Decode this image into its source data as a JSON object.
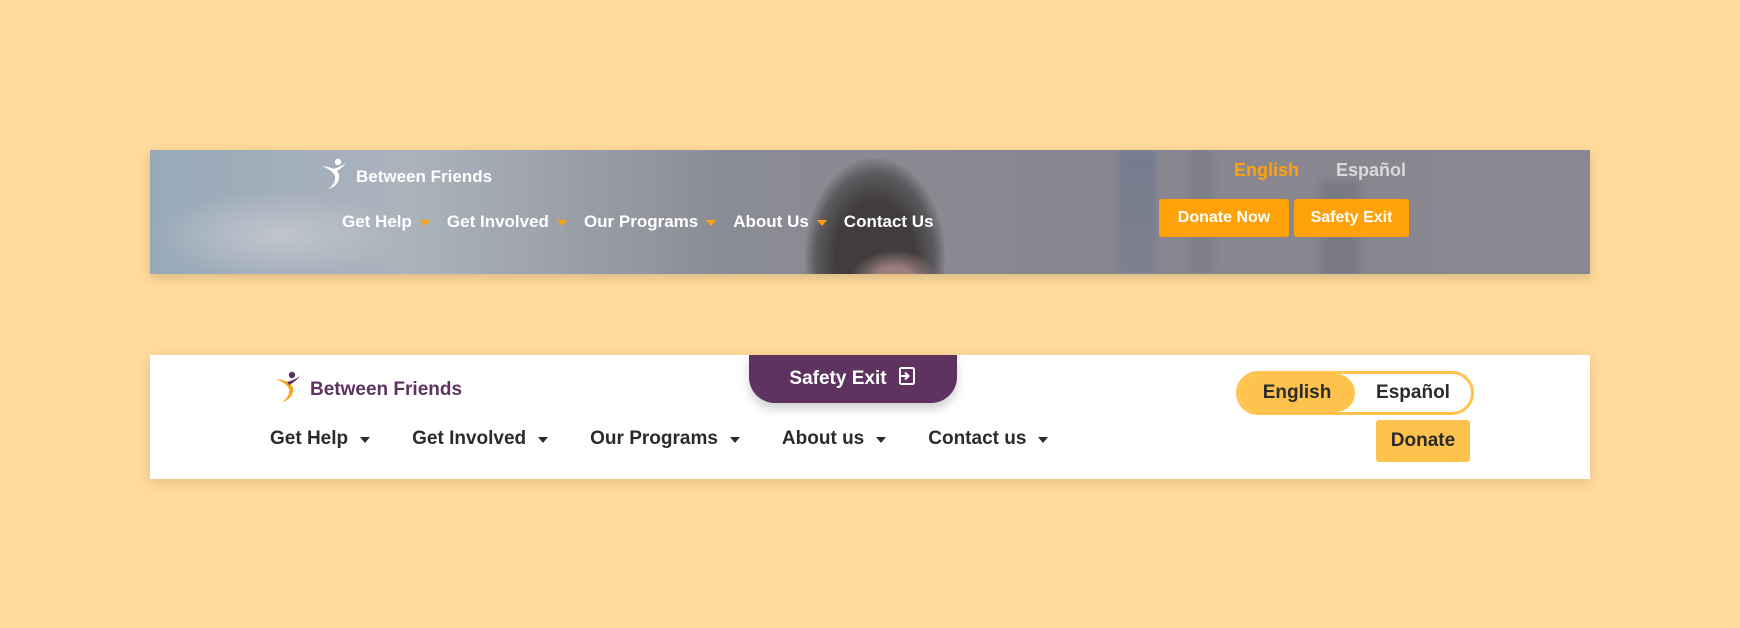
{
  "colors": {
    "background": "#FFDA9B",
    "old_accent": "#FFA20A",
    "new_accent": "#FFC24D",
    "brand_purple": "#5E3360"
  },
  "old_header": {
    "brand": "Between Friends",
    "logo_icon": "figure-logo-icon",
    "nav": [
      {
        "label": "Get Help",
        "has_dropdown": true
      },
      {
        "label": "Get Involved",
        "has_dropdown": true
      },
      {
        "label": "Our Programs",
        "has_dropdown": true
      },
      {
        "label": "About Us",
        "has_dropdown": true
      },
      {
        "label": "Contact Us",
        "has_dropdown": false
      }
    ],
    "languages": {
      "english": "English",
      "spanish": "Español",
      "selected": "English"
    },
    "donate_label": "Donate Now",
    "safety_exit_label": "Safety Exit"
  },
  "new_header": {
    "brand": "Between Friends",
    "logo_icon": "figure-logo-icon",
    "safety_exit_label": "Safety Exit",
    "safety_exit_icon": "exit-door-icon",
    "languages": {
      "english": "English",
      "spanish": "Español",
      "selected": "English"
    },
    "nav": [
      {
        "label": "Get Help",
        "has_dropdown": true
      },
      {
        "label": "Get Involved",
        "has_dropdown": true
      },
      {
        "label": "Our Programs",
        "has_dropdown": true
      },
      {
        "label": "About us",
        "has_dropdown": true
      },
      {
        "label": "Contact us",
        "has_dropdown": true
      }
    ],
    "donate_label": "Donate"
  }
}
